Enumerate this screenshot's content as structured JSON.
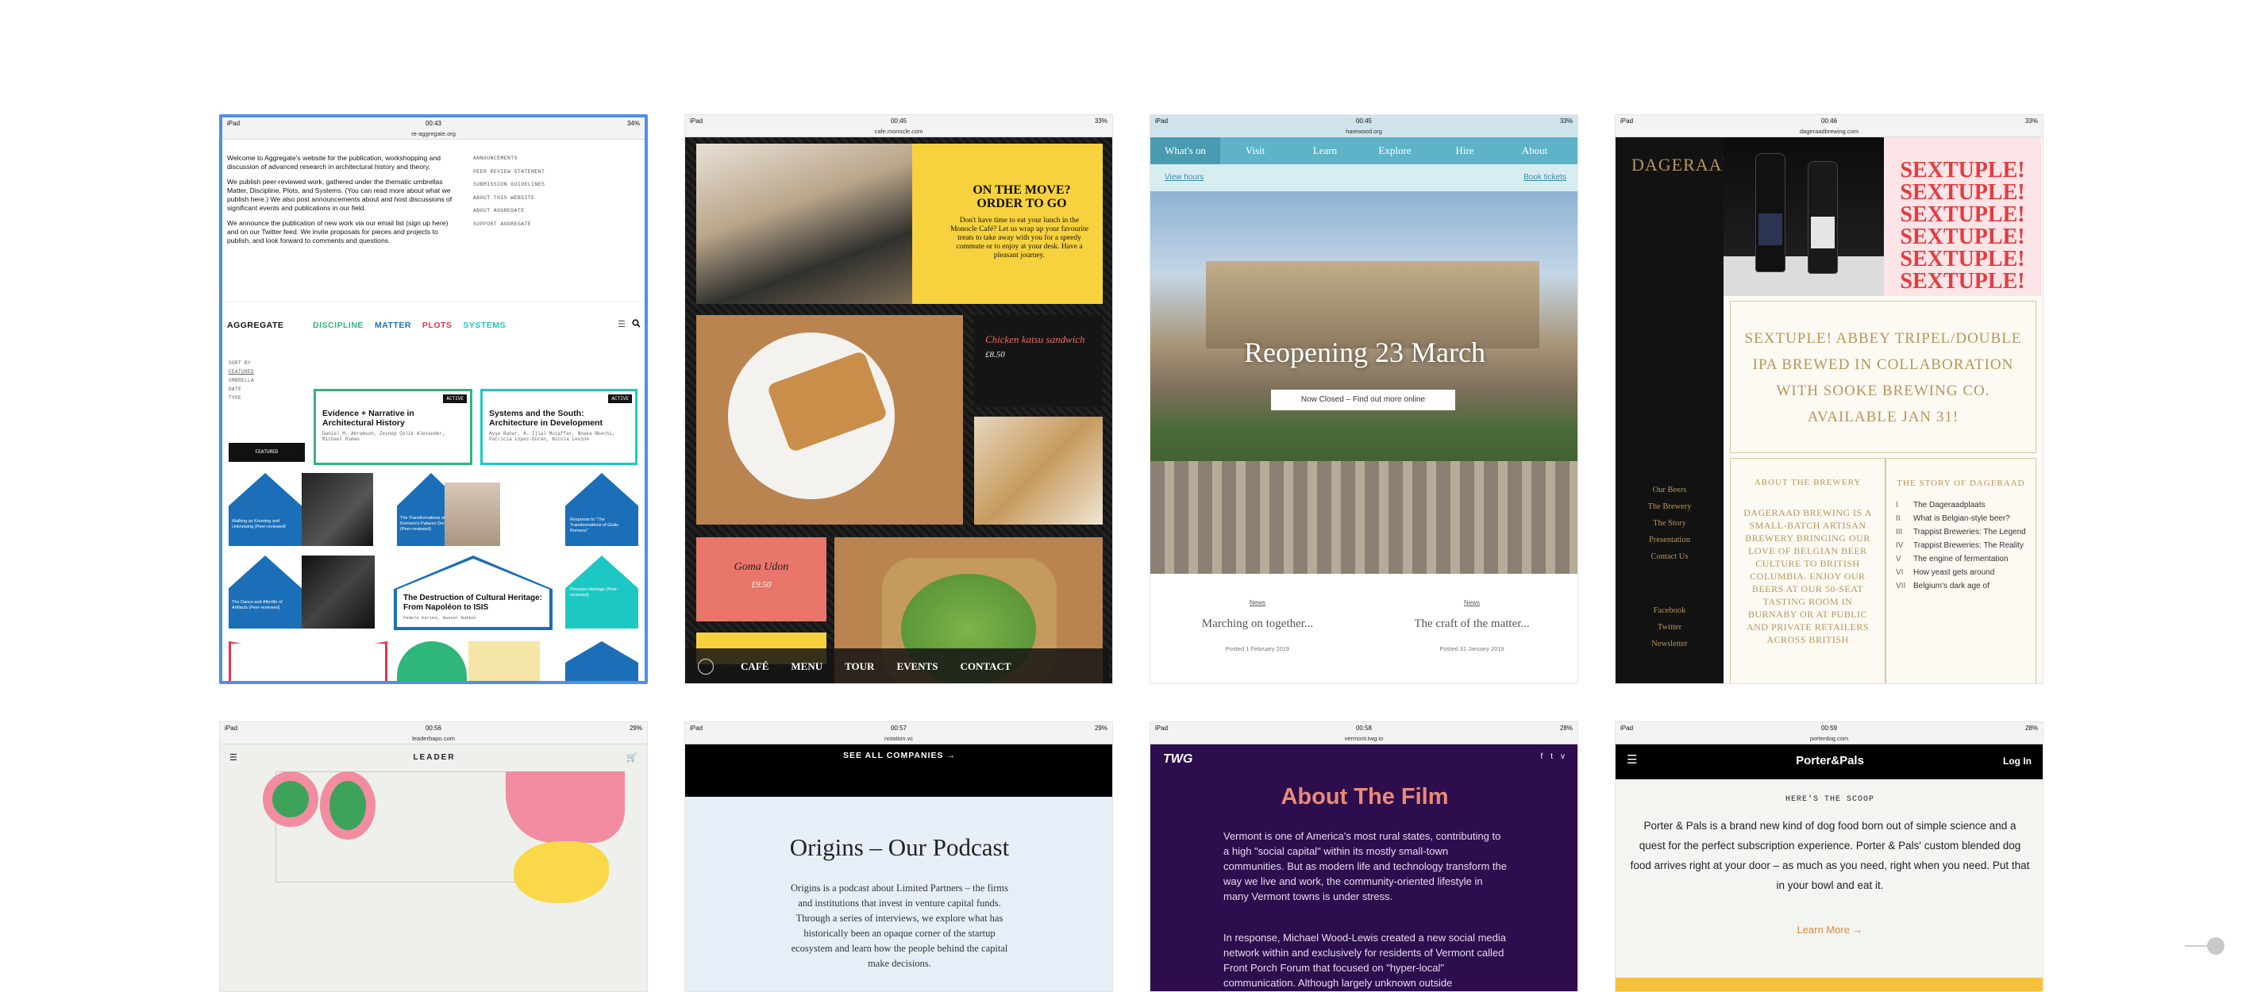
{
  "cards": [
    {
      "status": {
        "device": "iPad",
        "time": "00:43",
        "battery": "34%"
      },
      "url": "re-aggregate.org",
      "intro": [
        "Welcome to Aggregate's website for the publication, workshopping and discussion of advanced research in architectural history and theory.",
        "We publish peer-reviewed work, gathered under the thematic umbrellas Matter, Discipline, Plots, and Systems. (You can read more about what we publish here.) We also post announcements about and host discussions of significant events and publications in our field.",
        "We announce the publication of new work via our email list (sign up here) and on our Twitter feed. We invite proposals for pieces and projects to publish, and look forward to comments and questions."
      ],
      "menu": [
        "ANNOUNCEMENTS",
        "PEER REVIEW STATEMENT",
        "SUBMISSION GUIDELINES",
        "ABOUT THIS WEBSITE",
        "ABOUT AGGREGATE",
        "SUPPORT AGGREGATE"
      ],
      "logo": "AGGREGATE",
      "nav": [
        {
          "label": "DISCIPLINE",
          "color": "#2fb67a"
        },
        {
          "label": "MATTER",
          "color": "#1b6fb8"
        },
        {
          "label": "PLOTS",
          "color": "#e5334b"
        },
        {
          "label": "SYSTEMS",
          "color": "#1dc8c4"
        }
      ],
      "sort": [
        "SORT BY",
        "FEATURED",
        "UMBRELLA",
        "DATE",
        "TYPE"
      ],
      "featured": "FEATURED",
      "active": "ACTIVE",
      "features": [
        {
          "title": "Evidence + Narrative in Architectural History",
          "authors": "Daniel M. Abramson, Zeynep Çelik Alexander, Michael Osman"
        },
        {
          "title": "Systems and the South: Architecture in Development",
          "authors": "Ayşe Bahar, A. Ijlal Muzaffar, Nnaka Nkechi, Patricia López-Durán, Nicola Levine"
        }
      ],
      "tiles": [
        "Walking as Knowing and Unknowing (Peer-reviewed)",
        "The Transformations of Giulio Romano's Palazzo Del Te (Peer-reviewed)",
        "Response to \"The Transformations of Giulio Romano\"",
        "The Dance and Afterlife of Artifacts (Peer-reviewed)",
        "The Destruction of Cultural Heritage: From Napoléon to ISIS",
        "Peruvian Heritage (Peer-reviewed)"
      ],
      "destruction_authors": "Pamela Karimi, Nasser Rabbat"
    },
    {
      "status": {
        "device": "iPad",
        "time": "00:45",
        "battery": "33%"
      },
      "url": "cafe.monocle.com",
      "promo_title": "ON THE MOVE? ORDER TO GO",
      "promo_text": "Don't have time to eat your lunch in the Monocle Café? Let us wrap up your favourite treats to take away with you for a speedy commute or to enjoy at your desk. Have a pleasant journey.",
      "item1": {
        "name": "Chicken katsu sandwich",
        "price": "£8.50"
      },
      "item2": {
        "name": "Goma Udon",
        "price": "£9.50"
      },
      "nav": [
        "CAFÉ",
        "MENU",
        "TOUR",
        "EVENTS",
        "CONTACT"
      ]
    },
    {
      "status": {
        "device": "iPad",
        "time": "00:45",
        "battery": "33%"
      },
      "url": "harewood.org",
      "nav": [
        "What's on",
        "Visit",
        "Learn",
        "Explore",
        "Hire",
        "About"
      ],
      "view_hours": "View hours",
      "book_tickets": "Book tickets",
      "hero_title": "Reopening 23 March",
      "hero_button": "Now Closed – Find out more online",
      "news": [
        {
          "tag": "News",
          "title": "Marching on together...",
          "date": "Posted 1 February 2019"
        },
        {
          "tag": "News",
          "title": "The craft of the matter...",
          "date": "Posted 31 January 2019"
        }
      ]
    },
    {
      "status": {
        "device": "iPad",
        "time": "00:46",
        "battery": "33%"
      },
      "url": "dageraadbrewing.com",
      "logo": "DAGERAAD",
      "sextuple": "SEXTUPLE!",
      "menu": [
        "Our Beers",
        "The Brewery",
        "The Story",
        "Presentation",
        "Contact Us"
      ],
      "social": [
        "Facebook",
        "Twitter",
        "Newsletter"
      ],
      "headline": "SEXTUPLE! ABBEY TRIPEL/DOUBLE IPA BREWED IN COLLABORATION WITH SOOKE BREWING CO. AVAILABLE JAN 31!",
      "about_title": "ABOUT THE BREWERY",
      "about_text": "DAGERAAD BREWING IS A SMALL-BATCH ARTISAN BREWERY BRINGING OUR LOVE OF BELGIAN BEER CULTURE TO BRITISH COLUMBIA. ENJOY OUR BEERS AT OUR 50-SEAT TASTING ROOM IN BURNABY OR AT PUBLIC AND PRIVATE RETAILERS ACROSS BRITISH",
      "story_title": "THE STORY OF DAGERAAD",
      "story": [
        {
          "n": "I",
          "t": "The Dageraadplaats"
        },
        {
          "n": "II",
          "t": "What is Belgian-style beer?"
        },
        {
          "n": "III",
          "t": "Trappist Breweries: The Legend"
        },
        {
          "n": "IV",
          "t": "Trappist Breweries: The Reality"
        },
        {
          "n": "V",
          "t": "The engine of fermentation"
        },
        {
          "n": "VI",
          "t": "How yeast gets around"
        },
        {
          "n": "VII",
          "t": "Belgium's dark age of"
        }
      ]
    },
    {
      "status": {
        "device": "iPad",
        "time": "00:56",
        "battery": "29%"
      },
      "url": "leaderbapo.com",
      "logo": "LEADER"
    },
    {
      "status": {
        "device": "iPad",
        "time": "00:57",
        "battery": "29%"
      },
      "url": "notation.vc",
      "see_all": "SEE ALL COMPANIES",
      "title": "Origins – Our Podcast",
      "text": "Origins is a podcast about Limited Partners – the firms and institutions that invest in venture capital funds. Through a series of interviews, we explore what has historically been an opaque corner of the startup ecosystem and learn how the people behind the capital make decisions."
    },
    {
      "status": {
        "device": "iPad",
        "time": "00:58",
        "battery": "28%"
      },
      "url": "vermont.twg.io",
      "logo": "TWG",
      "title": "About The Film",
      "p1": "Vermont is one of America's most rural states, contributing to a high \"social capital\" within its mostly small-town communities. But as modern life and technology transform the way we live and work, the community-oriented lifestyle in many Vermont towns is under stress.",
      "p2": "In response, Michael Wood-Lewis created a new social media network within and exclusively for residents of Vermont called Front Porch Forum that focused on \"hyper-local\" communication. Although largely unknown outside"
    },
    {
      "status": {
        "device": "iPad",
        "time": "00:59",
        "battery": "28%"
      },
      "url": "porterdog.com",
      "logo": "Porter&Pals",
      "login": "Log In",
      "scoop": "HERE'S THE SCOOP",
      "text": "Porter & Pals is a brand new kind of dog food born out of simple science and a quest for the perfect subscription experience. Porter & Pals' custom blended dog food arrives right at your door – as much as you need, right when you need. Put that in your bowl and eat it.",
      "learn_more": "Learn More →"
    }
  ]
}
